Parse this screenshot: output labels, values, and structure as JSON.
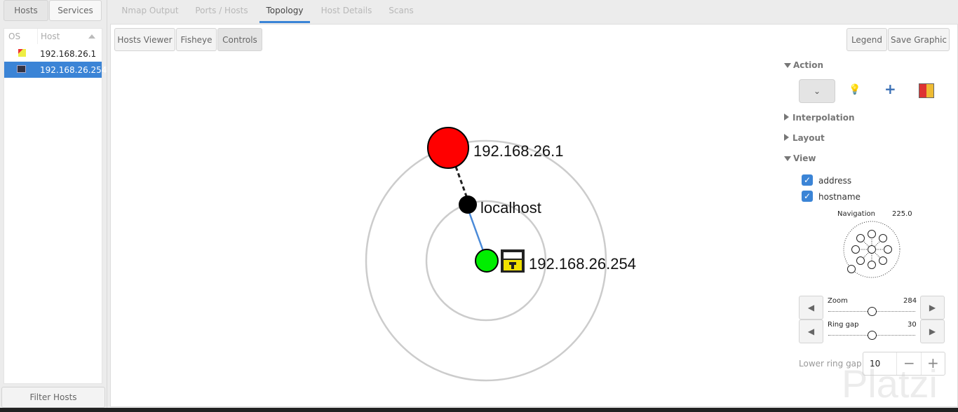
{
  "left_panel": {
    "tabs": [
      "Hosts",
      "Services"
    ],
    "columns": {
      "os": "OS",
      "host": "Host"
    },
    "hosts": [
      {
        "address": "192.168.26.1",
        "os_icon": "unknown-os-icon",
        "selected": false
      },
      {
        "address": "192.168.26.254",
        "os_icon": "windows-os-icon",
        "selected": true
      }
    ],
    "filter_button": "Filter Hosts"
  },
  "main_tabs": [
    {
      "label": "Nmap Output",
      "active": false
    },
    {
      "label": "Ports / Hosts",
      "active": false
    },
    {
      "label": "Topology",
      "active": true
    },
    {
      "label": "Host Details",
      "active": false
    },
    {
      "label": "Scans",
      "active": false
    }
  ],
  "toolbar": {
    "hosts_viewer": "Hosts Viewer",
    "fisheye": "Fisheye",
    "controls": "Controls",
    "legend": "Legend",
    "save_graphic": "Save Graphic"
  },
  "graph": {
    "nodes": [
      {
        "label": "192.168.26.1",
        "color": "#ff0000"
      },
      {
        "label": "localhost",
        "color": "#000000"
      },
      {
        "label": "192.168.26.254",
        "color": "#00ee00"
      }
    ]
  },
  "controls": {
    "action": "Action",
    "interpolation": "Interpolation",
    "layout": "Layout",
    "view": "View",
    "address": "address",
    "hostname": "hostname",
    "navigation": "Navigation",
    "navigation_value": "225.0",
    "zoom": "Zoom",
    "zoom_value": "284",
    "ring_gap": "Ring gap",
    "ring_gap_value": "30",
    "lower_ring_gap": "Lower ring gap",
    "lower_ring_gap_value": "10"
  },
  "watermark": "Platzi"
}
